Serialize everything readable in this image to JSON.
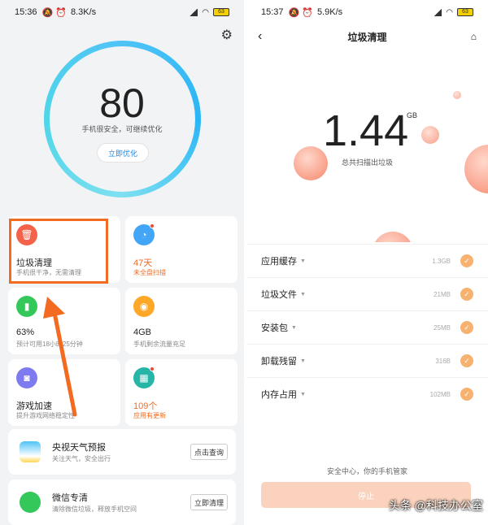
{
  "left": {
    "status": {
      "time": "15:36",
      "speed": "8.3K/s",
      "battery": "63"
    },
    "score": "80",
    "score_sub": "手机很安全，可继续优化",
    "optimize_button": "立即优化",
    "cards": [
      {
        "title": "垃圾清理",
        "sub": "手机很干净，无需清理",
        "color": "#f4624a"
      },
      {
        "title": "47天",
        "sub": "未全盘扫描",
        "color": "#42a5f5"
      },
      {
        "title": "63%",
        "sub": "预计可用18小时25分钟",
        "color": "#34c759"
      },
      {
        "title": "4GB",
        "sub": "手机剩余流量充足",
        "color": "#ffa726"
      },
      {
        "title": "游戏加速",
        "sub": "提升游戏网络稳定性",
        "color": "#7e7bf0"
      },
      {
        "title": "109个",
        "sub": "应用有更新",
        "color": "#26b5a6"
      }
    ],
    "weather": {
      "title": "央视天气预报",
      "sub": "关注天气，安全出行",
      "button": "点击查询"
    },
    "wechat": {
      "title": "微信专清",
      "sub": "清除微信垃圾，释放手机空间",
      "button": "立即清理"
    }
  },
  "right": {
    "status": {
      "time": "15:37",
      "speed": "5.9K/s",
      "battery": "63"
    },
    "title": "垃圾清理",
    "amount": "1.44",
    "unit": "GB",
    "amount_sub": "总共扫描出垃圾",
    "items": [
      {
        "name": "应用缓存",
        "size": "1.3GB"
      },
      {
        "name": "垃圾文件",
        "size": "21MB"
      },
      {
        "name": "安装包",
        "size": "25MB"
      },
      {
        "name": "卸载残留",
        "size": "316B"
      },
      {
        "name": "内存占用",
        "size": "102MB"
      }
    ],
    "footer": "安全中心，你的手机管家",
    "stop_button": "停止"
  },
  "watermark": "头条 @科技办公室"
}
